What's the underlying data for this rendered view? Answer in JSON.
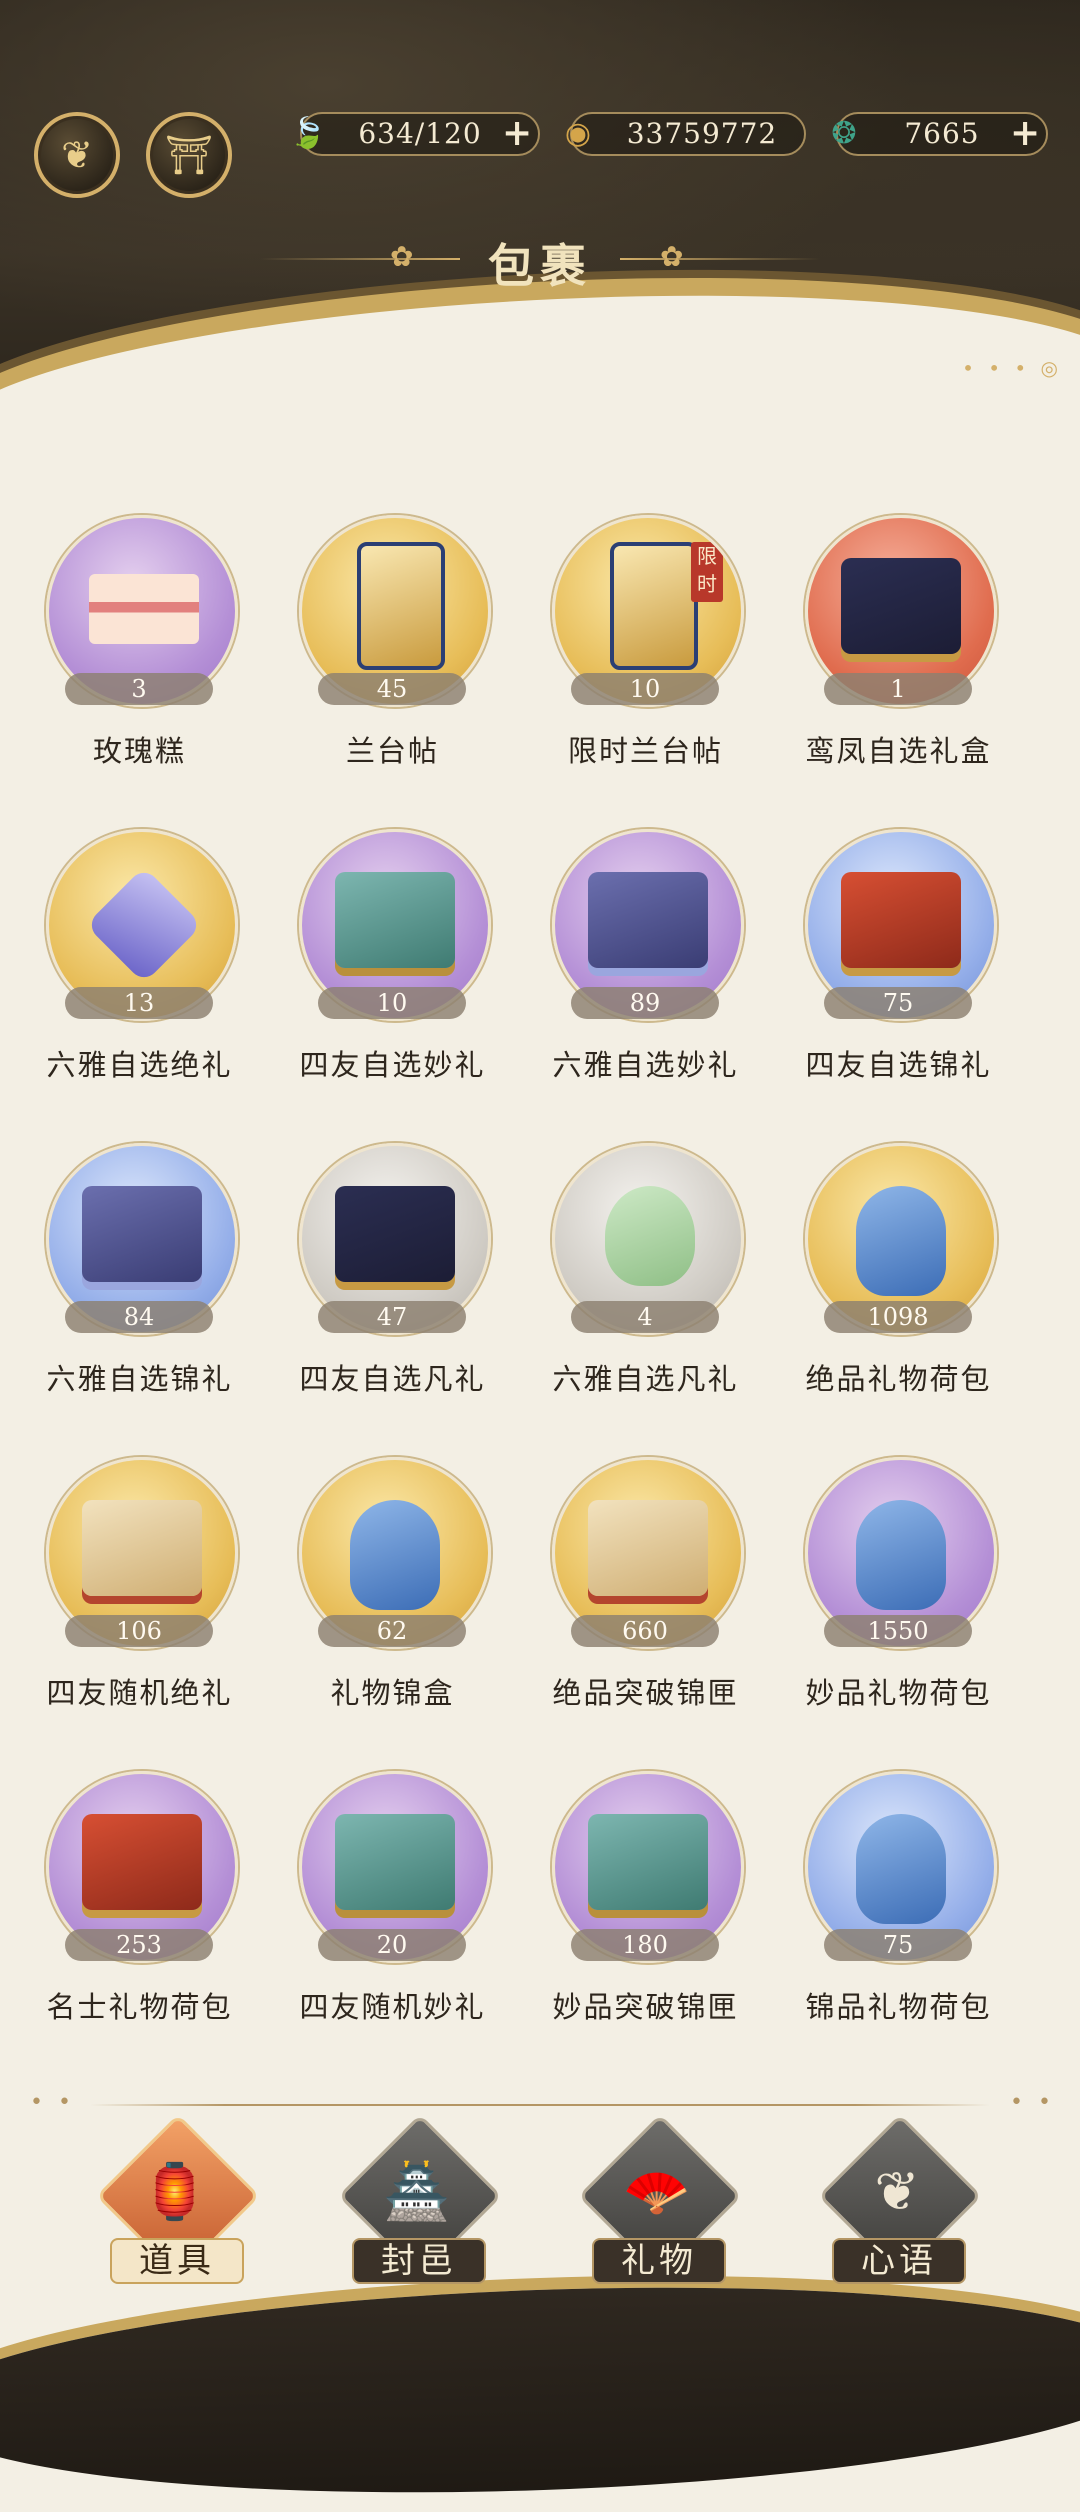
{
  "header": {
    "title": "包裹",
    "left_buttons": [
      {
        "icon": "leaf-emblem-icon",
        "glyph": "❦"
      },
      {
        "icon": "pavilion-icon",
        "glyph": "⛩"
      }
    ],
    "resources": [
      {
        "icon": "jade-leaf-icon",
        "glyph": "🍃",
        "value": "634/120",
        "has_plus": true,
        "color": "#9bc46a"
      },
      {
        "icon": "copper-coin-icon",
        "glyph": "◉",
        "value": "33759772",
        "has_plus": false,
        "color": "#d4a54a"
      },
      {
        "icon": "jade-pendant-icon",
        "glyph": "❂",
        "value": "7665",
        "has_plus": true,
        "color": "#3fa38a"
      }
    ]
  },
  "items": [
    {
      "name": "玫瑰糕",
      "count": "3",
      "bg": "purple",
      "art": "cake"
    },
    {
      "name": "兰台帖",
      "count": "45",
      "bg": "gold",
      "art": "ticket"
    },
    {
      "name": "限时兰台帖",
      "count": "10",
      "bg": "gold",
      "art": "ticket",
      "tag": "限时"
    },
    {
      "name": "鸾凤自选礼盒",
      "count": "1",
      "bg": "red",
      "art": "chest"
    },
    {
      "name": "六雅自选绝礼",
      "count": "13",
      "bg": "gold",
      "art": "gem"
    },
    {
      "name": "四友自选妙礼",
      "count": "10",
      "bg": "purple",
      "art": "box"
    },
    {
      "name": "六雅自选妙礼",
      "count": "89",
      "bg": "purple",
      "art": "flowerbox"
    },
    {
      "name": "四友自选锦礼",
      "count": "75",
      "bg": "blue",
      "art": "redchest"
    },
    {
      "name": "六雅自选锦礼",
      "count": "84",
      "bg": "blue",
      "art": "flowerbox"
    },
    {
      "name": "四友自选凡礼",
      "count": "47",
      "bg": "gray",
      "art": "chest"
    },
    {
      "name": "六雅自选凡礼",
      "count": "4",
      "bg": "gray",
      "art": "pouch"
    },
    {
      "name": "绝品礼物荷包",
      "count": "1098",
      "bg": "gold",
      "art": "bag"
    },
    {
      "name": "四友随机绝礼",
      "count": "106",
      "bg": "gold",
      "art": "scroll"
    },
    {
      "name": "礼物锦盒",
      "count": "62",
      "bg": "gold",
      "art": "bag"
    },
    {
      "name": "绝品突破锦匣",
      "count": "660",
      "bg": "gold",
      "art": "scroll"
    },
    {
      "name": "妙品礼物荷包",
      "count": "1550",
      "bg": "purple",
      "art": "bag"
    },
    {
      "name": "名士礼物荷包",
      "count": "253",
      "bg": "purple",
      "art": "redchest"
    },
    {
      "name": "四友随机妙礼",
      "count": "20",
      "bg": "purple",
      "art": "box"
    },
    {
      "name": "妙品突破锦匣",
      "count": "180",
      "bg": "purple",
      "art": "box"
    },
    {
      "name": "锦品礼物荷包",
      "count": "75",
      "bg": "blue",
      "art": "bag"
    }
  ],
  "tabs": [
    {
      "label": "道具",
      "icon": "lantern-icon",
      "glyph": "🏮",
      "active": true
    },
    {
      "label": "封邑",
      "icon": "palace-icon",
      "glyph": "🏯",
      "active": false
    },
    {
      "label": "礼物",
      "icon": "fan-icon",
      "glyph": "🪭",
      "active": false
    },
    {
      "label": "心语",
      "icon": "heart-knot-icon",
      "glyph": "❦",
      "active": false
    }
  ]
}
